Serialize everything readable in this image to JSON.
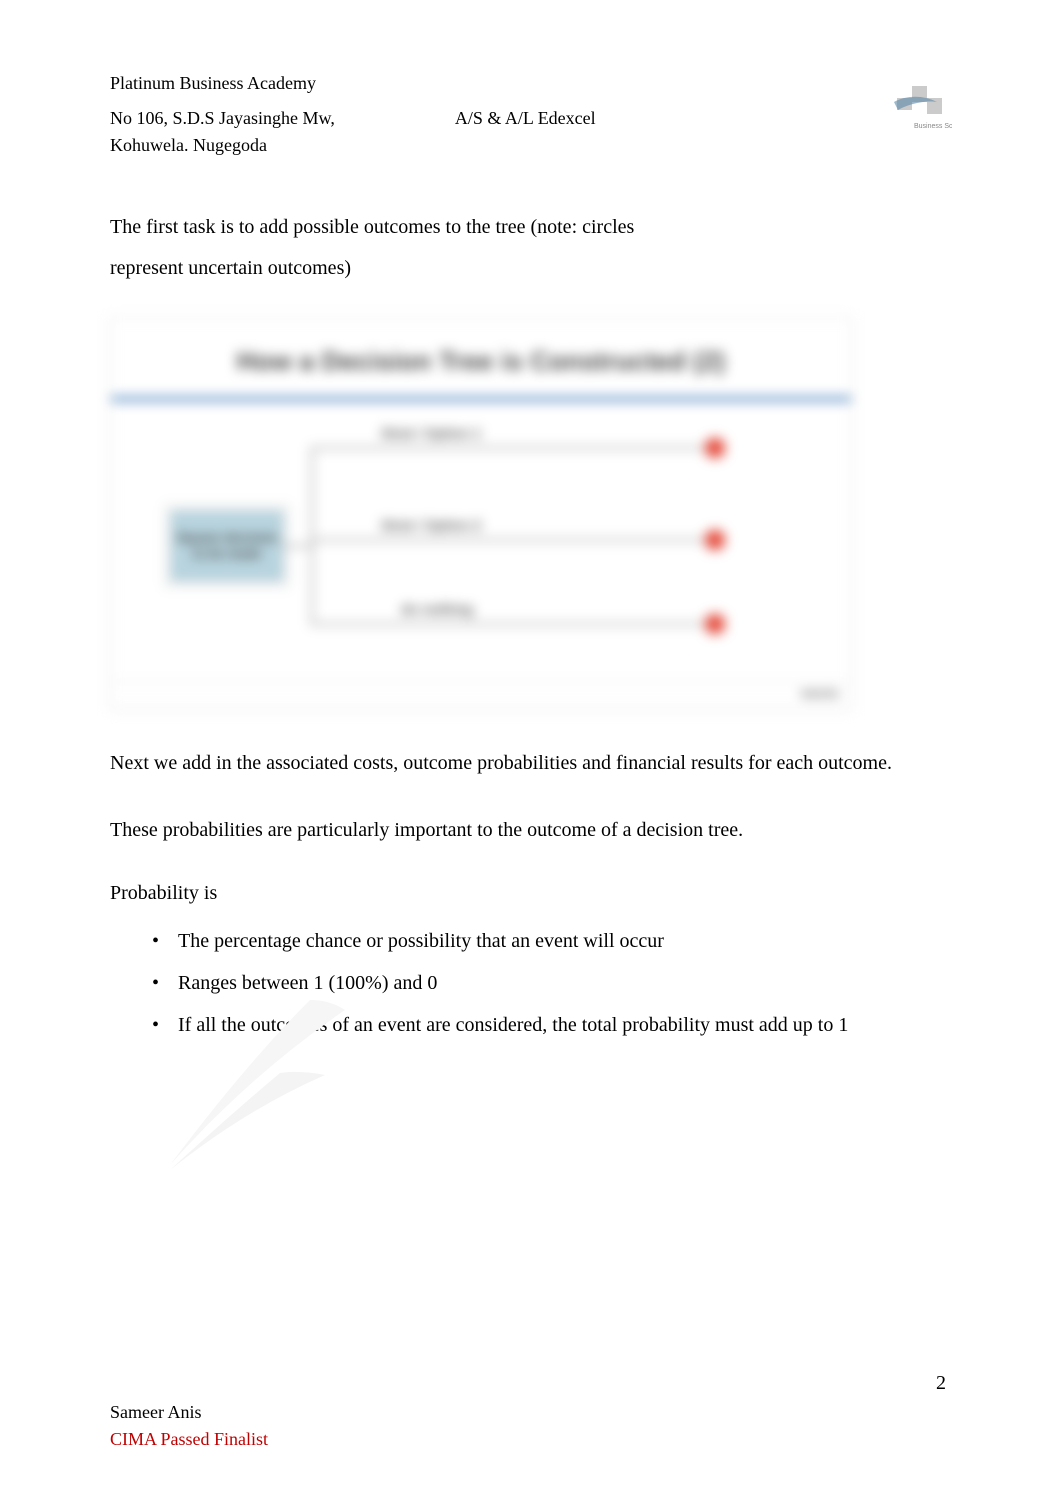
{
  "header": {
    "institution": "Platinum Business Academy",
    "address_line1": "No 106, S.D.S Jayasinghe Mw,",
    "address_line2": "Kohuwela. Nugegoda",
    "course": "A/S & A/L Edexcel"
  },
  "paragraphs": {
    "p1_line1": "The first task is to add possible outcomes to the tree (note: circles",
    "p1_line2": "represent uncertain outcomes)",
    "p2": "Next we add in the associated costs, outcome probabilities and financial results for each outcome.",
    "p3": "These probabilities are particularly important to the outcome of a decision tree.",
    "p4": "Probability is"
  },
  "figure": {
    "title": "How a Decision Tree is Constructed (2)",
    "square_label": "Square decision to be made",
    "branch1": "Strat / Option 1",
    "branch2": "Strat / Option 2",
    "branch3": "do nothing",
    "footer_brand": "tutor2u"
  },
  "bullets": {
    "b1": "The percentage chance or possibility that an event will occur",
    "b2": "Ranges between 1 (100%) and 0",
    "b3": "If all the outcomes of an event are considered, the total probability must add up to 1"
  },
  "page_number": "2",
  "footer": {
    "author": "Sameer Anis",
    "credential": "CIMA Passed Finalist"
  }
}
